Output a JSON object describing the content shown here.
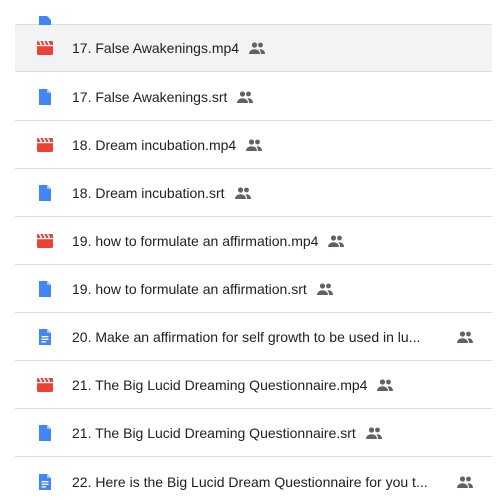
{
  "colors": {
    "video_icon": "#ea4335",
    "doc_icon": "#4285f4",
    "text": "#202124",
    "divider": "#dadce0",
    "selected_bg": "#f1f3f4",
    "shared_icon": "#5f6368"
  },
  "files": [
    {
      "name": "17. False Awakenings.mp4",
      "icon": "video-file-icon",
      "shared": true
    },
    {
      "name": "17. False Awakenings.srt",
      "icon": "doc-file-icon",
      "shared": true
    },
    {
      "name": "18. Dream incubation.mp4",
      "icon": "video-file-icon",
      "shared": true
    },
    {
      "name": "18. Dream incubation.srt",
      "icon": "doc-file-icon",
      "shared": true
    },
    {
      "name": "19. how to formulate an affirmation.mp4",
      "icon": "video-file-icon",
      "shared": true
    },
    {
      "name": "19. how to formulate an affirmation.srt",
      "icon": "doc-file-icon",
      "shared": true
    },
    {
      "name": "20. Make an affirmation for self growth to be used in lu...",
      "icon": "google-doc-icon",
      "shared": true
    },
    {
      "name": "21. The Big Lucid Dreaming Questionnaire.mp4",
      "icon": "video-file-icon",
      "shared": true
    },
    {
      "name": "21. The Big Lucid Dreaming Questionnaire.srt",
      "icon": "doc-file-icon",
      "shared": true
    },
    {
      "name": "22. Here is  the Big Lucid Dream Questionnaire for you t...",
      "icon": "google-doc-icon",
      "shared": true
    }
  ]
}
